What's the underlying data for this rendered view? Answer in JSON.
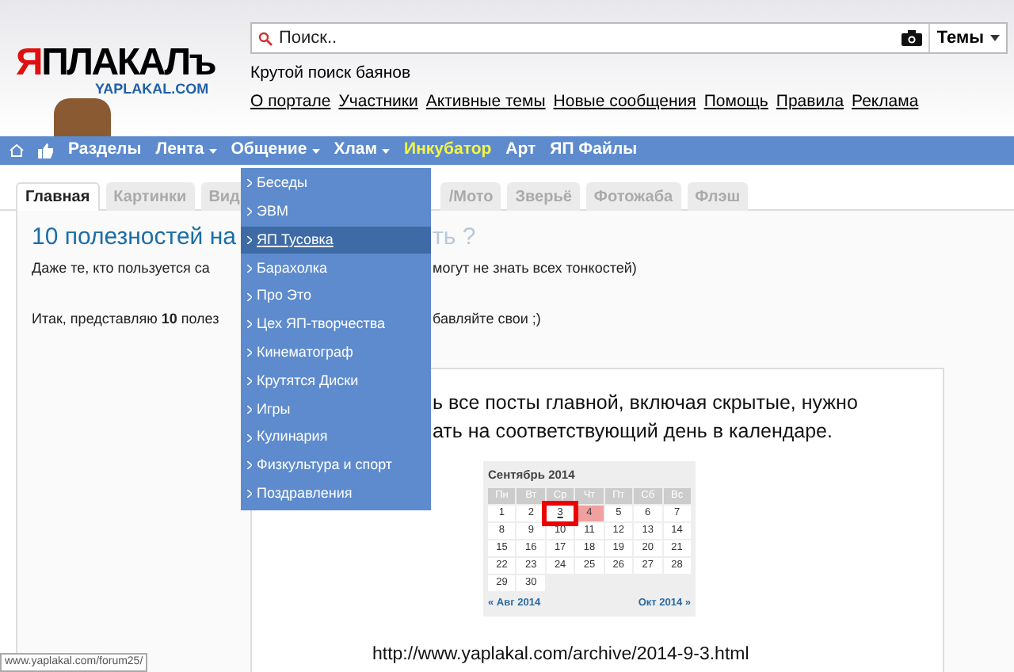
{
  "logo": {
    "mark": "Я",
    "text": "ПЛАКАЛъ",
    "domain": "YAPLAKAL.COM"
  },
  "search": {
    "placeholder": "Поиск..",
    "scope": "Темы"
  },
  "tagline": "Крутой поиск баянов",
  "top_links": [
    "О портале",
    "Участники",
    "Активные темы",
    "Новые сообщения",
    "Помощь",
    "Правила",
    "Реклама"
  ],
  "nav": [
    {
      "kind": "home"
    },
    {
      "kind": "like"
    },
    {
      "kind": "link",
      "label": "Разделы",
      "dropdown": false,
      "expanded": false
    },
    {
      "kind": "link",
      "label": "Лента",
      "dropdown": true,
      "expanded": false
    },
    {
      "kind": "link",
      "label": "Общение",
      "dropdown": true,
      "expanded": true
    },
    {
      "kind": "link",
      "label": "Хлам",
      "dropdown": true,
      "expanded": false
    },
    {
      "kind": "accent",
      "label": "Инкубатор",
      "dropdown": false,
      "expanded": false
    },
    {
      "kind": "link",
      "label": "Арт",
      "dropdown": false,
      "expanded": false
    },
    {
      "kind": "link",
      "label": "ЯП Файлы",
      "dropdown": false,
      "expanded": false
    }
  ],
  "menu": [
    {
      "label": "Беседы",
      "selected": false
    },
    {
      "label": "ЭВМ",
      "selected": false
    },
    {
      "label": "ЯП Тусовка",
      "selected": true
    },
    {
      "label": "Барахолка",
      "selected": false
    },
    {
      "label": "Про Это",
      "selected": false
    },
    {
      "label": "Цех ЯП-творчества",
      "selected": false
    },
    {
      "label": "Кинематограф",
      "selected": false
    },
    {
      "label": "Крутятся Диски",
      "selected": false
    },
    {
      "label": "Игры",
      "selected": false
    },
    {
      "label": "Кулинария",
      "selected": false
    },
    {
      "label": "Физкультура и спорт",
      "selected": false
    },
    {
      "label": "Поздравления",
      "selected": false
    }
  ],
  "tabs": [
    {
      "label": "Главная",
      "selected": true
    },
    {
      "label": "Картинки",
      "selected": false
    },
    {
      "label": "Вид",
      "selected": false
    },
    {
      "label": "/Мото",
      "selected": false
    },
    {
      "label": "Зверьё",
      "selected": false
    },
    {
      "label": "Фотожаба",
      "selected": false
    },
    {
      "label": "Флэш",
      "selected": false
    }
  ],
  "post": {
    "title_left": "10 полезностей на",
    "title_right": "ть ?",
    "line_1_left": "Даже те, кто пользуется са",
    "line_1_right": "могут не знать всех тонкостей)",
    "line_2_left": "Итак, представляю **10** полез",
    "line_2_right": "бавляйте свои ;)"
  },
  "image": {
    "text_1": "ь все посты главной, включая скрытые, нужно",
    "text_2": "ать на соответствующий день в календаре.",
    "url": "http://www.yaplakal.com/archive/2014-9-3.html",
    "calendar": {
      "title": "Сентябрь 2014",
      "weekdays": [
        "Пн",
        "Вт",
        "Ср",
        "Чт",
        "Пт",
        "Сб",
        "Вс"
      ],
      "days": [
        {
          "label": "1",
          "selected": false,
          "highlighted": false
        },
        {
          "label": "2",
          "selected": false,
          "highlighted": false
        },
        {
          "label": "3",
          "selected": true,
          "highlighted": false
        },
        {
          "label": "4",
          "selected": false,
          "highlighted": true
        },
        {
          "label": "5",
          "selected": false,
          "highlighted": false
        },
        {
          "label": "6",
          "selected": false,
          "highlighted": false
        },
        {
          "label": "7",
          "selected": false,
          "highlighted": false
        },
        {
          "label": "8",
          "selected": false,
          "highlighted": false
        },
        {
          "label": "9",
          "selected": false,
          "highlighted": false
        },
        {
          "label": "10",
          "selected": false,
          "highlighted": false
        },
        {
          "label": "11",
          "selected": false,
          "highlighted": false
        },
        {
          "label": "12",
          "selected": false,
          "highlighted": false
        },
        {
          "label": "13",
          "selected": false,
          "highlighted": false
        },
        {
          "label": "14",
          "selected": false,
          "highlighted": false
        },
        {
          "label": "15",
          "selected": false,
          "highlighted": false
        },
        {
          "label": "16",
          "selected": false,
          "highlighted": false
        },
        {
          "label": "17",
          "selected": false,
          "highlighted": false
        },
        {
          "label": "18",
          "selected": false,
          "highlighted": false
        },
        {
          "label": "19",
          "selected": false,
          "highlighted": false
        },
        {
          "label": "20",
          "selected": false,
          "highlighted": false
        },
        {
          "label": "21",
          "selected": false,
          "highlighted": false
        },
        {
          "label": "22",
          "selected": false,
          "highlighted": false
        },
        {
          "label": "23",
          "selected": false,
          "highlighted": false
        },
        {
          "label": "24",
          "selected": false,
          "highlighted": false
        },
        {
          "label": "25",
          "selected": false,
          "highlighted": false
        },
        {
          "label": "26",
          "selected": false,
          "highlighted": false
        },
        {
          "label": "27",
          "selected": false,
          "highlighted": false
        },
        {
          "label": "28",
          "selected": false,
          "highlighted": false
        },
        {
          "label": "29",
          "selected": false,
          "highlighted": false
        },
        {
          "label": "30",
          "selected": false,
          "highlighted": false
        }
      ],
      "prev": "« Авг 2014",
      "next": "Окт 2014 »"
    }
  },
  "status_bar": "www.yaplakal.com/forum25/"
}
